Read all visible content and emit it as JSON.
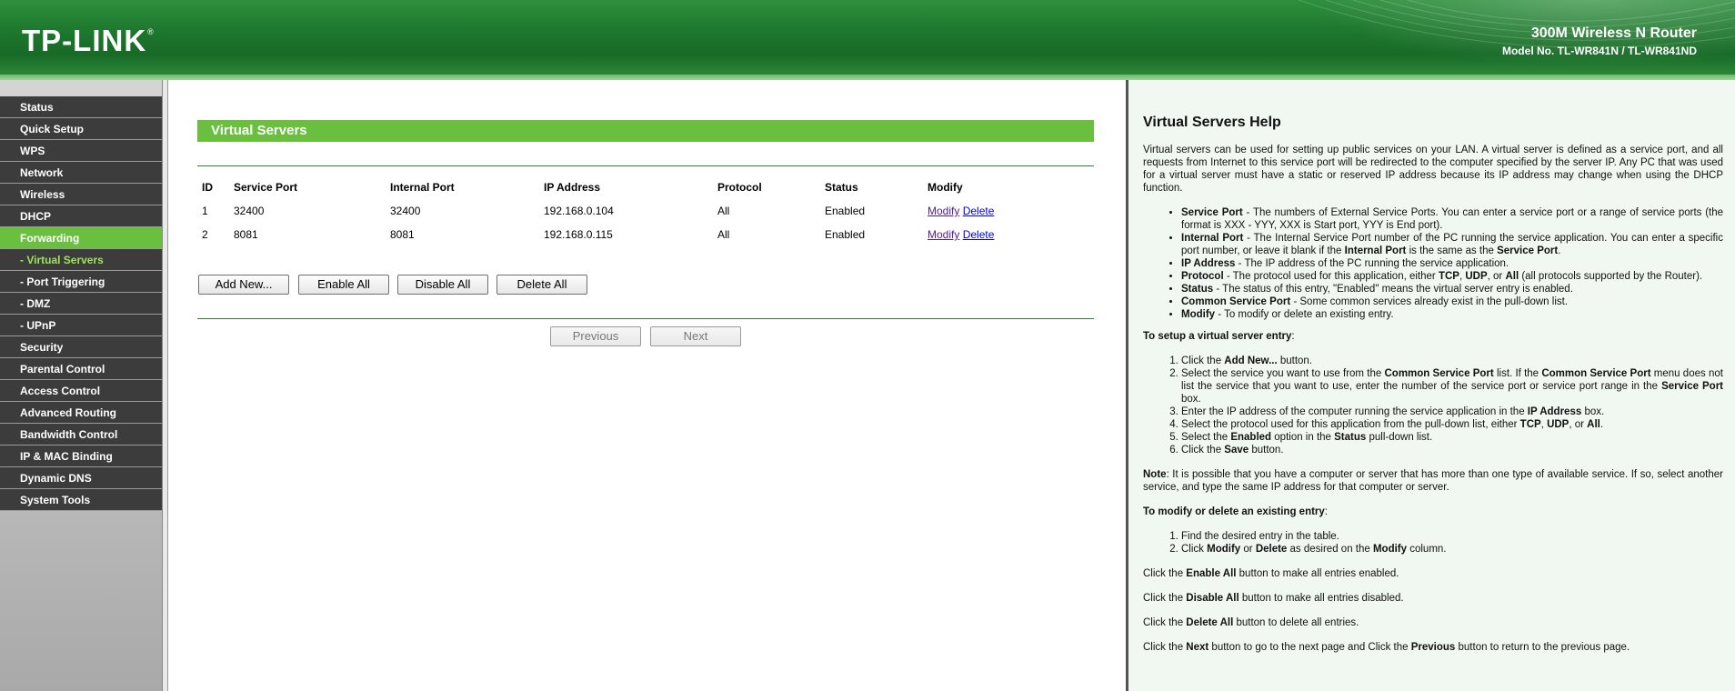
{
  "header": {
    "logo": "TP-LINK",
    "logo_mark": "®",
    "product_name": "300M Wireless N Router",
    "model": "Model No. TL-WR841N / TL-WR841ND"
  },
  "menu": [
    {
      "label": "Status",
      "state": "normal"
    },
    {
      "label": "Quick Setup",
      "state": "normal"
    },
    {
      "label": "WPS",
      "state": "normal"
    },
    {
      "label": "Network",
      "state": "normal"
    },
    {
      "label": "Wireless",
      "state": "normal"
    },
    {
      "label": "DHCP",
      "state": "normal"
    },
    {
      "label": "Forwarding",
      "state": "active"
    },
    {
      "label": "- Virtual Servers",
      "state": "sub-active"
    },
    {
      "label": "- Port Triggering",
      "state": "sub"
    },
    {
      "label": "- DMZ",
      "state": "sub"
    },
    {
      "label": "- UPnP",
      "state": "sub"
    },
    {
      "label": "Security",
      "state": "normal"
    },
    {
      "label": "Parental Control",
      "state": "normal"
    },
    {
      "label": "Access Control",
      "state": "normal"
    },
    {
      "label": "Advanced Routing",
      "state": "normal"
    },
    {
      "label": "Bandwidth Control",
      "state": "normal"
    },
    {
      "label": "IP & MAC Binding",
      "state": "normal"
    },
    {
      "label": "Dynamic DNS",
      "state": "normal"
    },
    {
      "label": "System Tools",
      "state": "normal"
    }
  ],
  "main": {
    "title": "Virtual Servers",
    "columns": [
      "ID",
      "Service Port",
      "Internal Port",
      "IP Address",
      "Protocol",
      "Status",
      "Modify"
    ],
    "rows": [
      {
        "id": "1",
        "service_port": "32400",
        "internal_port": "32400",
        "ip": "192.168.0.104",
        "protocol": "All",
        "status": "Enabled",
        "modify": "Modify",
        "delete": "Delete"
      },
      {
        "id": "2",
        "service_port": "8081",
        "internal_port": "8081",
        "ip": "192.168.0.115",
        "protocol": "All",
        "status": "Enabled",
        "modify": "Modify",
        "delete": "Delete"
      }
    ],
    "buttons": {
      "add_new": "Add New...",
      "enable_all": "Enable All",
      "disable_all": "Disable All",
      "delete_all": "Delete All",
      "previous": "Previous",
      "next": "Next"
    }
  },
  "help": {
    "title": "Virtual Servers Help",
    "intro": "Virtual servers can be used for setting up public services on your LAN. A virtual server is defined as a service port, and all requests from Internet to this service port will be redirected to the computer specified by the server IP. Any PC that was used for a virtual server must have a static or reserved IP address because its IP address may change when using the DHCP function.",
    "defs": [
      {
        "term": "Service Port",
        "text": " - The numbers of External Service Ports. You can enter a service port or a range of service ports (the format is XXX - YYY, XXX is Start port, YYY is End port)."
      },
      {
        "term": "Internal Port",
        "text": " - The Internal Service Port number of the PC running the service application. You can enter a specific port number, or leave it blank if the ",
        "term2": "Internal Port",
        "text2": " is the same as the ",
        "term3": "Service Port",
        "text3": "."
      },
      {
        "term": "IP Address",
        "text": " - The IP address of the PC running the service application."
      },
      {
        "term": "Protocol",
        "text": " - The protocol used for this application, either ",
        "term2": "TCP",
        "text2": ", ",
        "term3": "UDP",
        "text3": ", or ",
        "term4": "All",
        "text4": " (all protocols supported by the Router)."
      },
      {
        "term": "Status",
        "text": " - The status of this entry, \"Enabled\" means the virtual server entry is enabled."
      },
      {
        "term": "Common Service Port",
        "text": " - Some common services already exist in the pull-down list."
      },
      {
        "term": "Modify",
        "text": " - To modify or delete an existing entry."
      }
    ],
    "setup_heading": "To setup a virtual server entry",
    "setup_steps": [
      [
        "Click the ",
        "Add New...",
        " button."
      ],
      [
        "Select the service you want to use from the ",
        "Common Service Port",
        " list. If the ",
        "Common Service Port",
        " menu does not list the service that you want to use, enter the number of the service port or service port range in the ",
        "Service Port",
        " box."
      ],
      [
        "Enter the IP address of the computer running the service application in the ",
        "IP Address",
        " box."
      ],
      [
        "Select the protocol used for this application from the pull-down list, either ",
        "TCP",
        ", ",
        "UDP",
        ", or ",
        "All",
        "."
      ],
      [
        "Select the ",
        "Enabled",
        " option in the ",
        "Status",
        " pull-down list."
      ],
      [
        "Click the ",
        "Save",
        " button."
      ]
    ],
    "note_label": "Note",
    "note": ": It is possible that you have a computer or server that has more than one type of available service. If so, select another service, and type the same IP address for that computer or server.",
    "modify_heading": "To modify or delete an existing entry",
    "modify_steps": [
      [
        "Find the desired entry in the table."
      ],
      [
        "Click ",
        "Modify",
        " or ",
        "Delete",
        " as desired on the ",
        "Modify",
        " column."
      ]
    ],
    "lines": [
      [
        "Click the ",
        "Enable All",
        " button to make all entries enabled."
      ],
      [
        "Click the ",
        "Disable All",
        " button to make all entries disabled."
      ],
      [
        "Click the ",
        "Delete All",
        " button to delete all entries."
      ],
      [
        "Click the ",
        "Next",
        " button to go to the next page and Click the ",
        "Previous",
        " button to return to the previous page."
      ]
    ]
  }
}
